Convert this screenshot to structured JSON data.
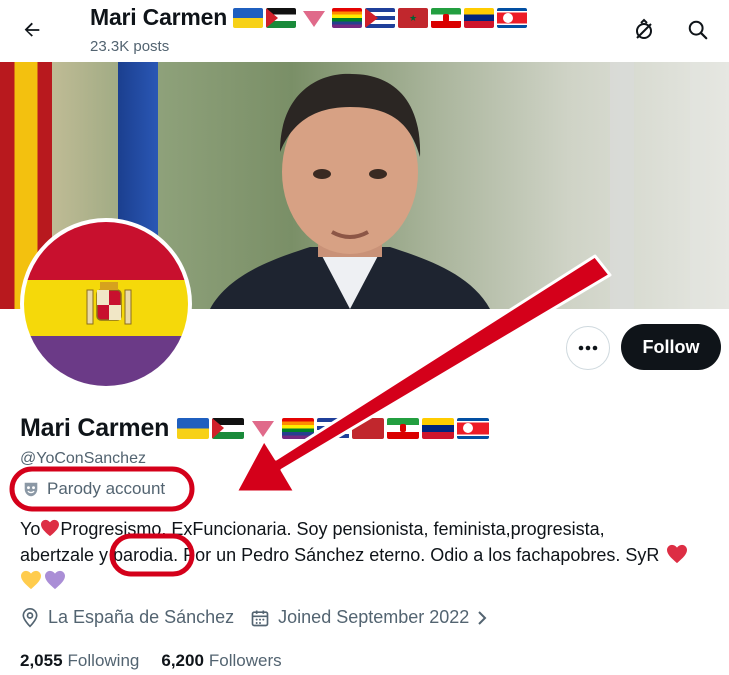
{
  "header": {
    "name": "Mari Carmen",
    "posts": "23.3K posts"
  },
  "icons": {
    "back": "arrow-left-icon",
    "lists": "list-slash-icon",
    "search": "search-icon",
    "more": "more-horizontal-icon",
    "parody": "theater-mask-icon",
    "location": "location-pin-icon",
    "calendar": "calendar-icon",
    "chevron": "chevron-right-icon"
  },
  "actions": {
    "more_label": "•••",
    "follow_label": "Follow"
  },
  "profile": {
    "name": "Mari Carmen",
    "handle": "@YoConSanchez",
    "parody_label": "Parody account",
    "bio_line1_a": "Yo",
    "bio_line1_b": "Progresismo. ExFuncionaria. Soy pensionista, feminista,progresista,",
    "bio_line2": "abertzale y parodia. Por un Pedro Sánchez eterno. Odio a los fachapobres. SyR",
    "location": "La España de Sánchez",
    "joined": "Joined September 2022",
    "following_count": "2,055",
    "following_label": "Following",
    "followers_count": "6,200",
    "followers_label": "Followers"
  },
  "colors": {
    "accent_dark": "#0f1419",
    "secondary_text": "#536471",
    "annotation_red": "#d4001a",
    "heart_red": "#e0245e",
    "heart_yellow": "#ffcc4d",
    "heart_purple": "#aa8ed6"
  }
}
